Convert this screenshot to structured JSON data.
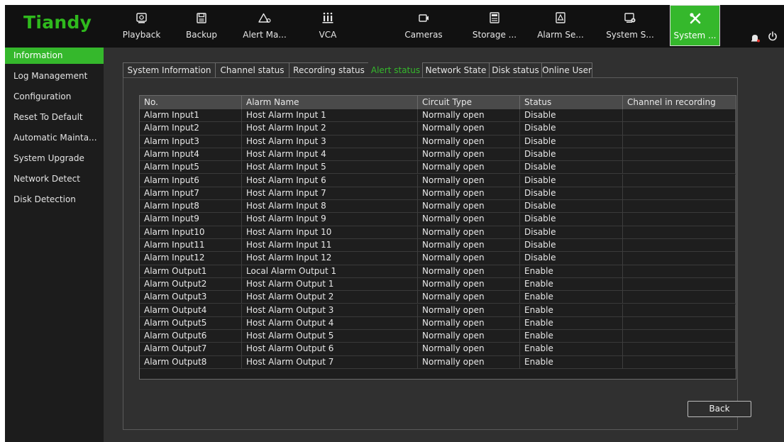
{
  "brand": {
    "logo_text": "Tiandy",
    "accent": "#35b82c"
  },
  "nav": [
    {
      "label": "Playback",
      "icon": "playback-icon"
    },
    {
      "label": "Backup",
      "icon": "backup-icon"
    },
    {
      "label": "Alert Ma...",
      "icon": "alert-icon"
    },
    {
      "label": "VCA",
      "icon": "vca-icon"
    },
    {
      "label": "Cameras",
      "icon": "camera-icon"
    },
    {
      "label": "Storage ...",
      "icon": "storage-icon"
    },
    {
      "label": "Alarm Se...",
      "icon": "alarm-settings-icon"
    },
    {
      "label": "System S...",
      "icon": "system-settings-icon"
    },
    {
      "label": "System ...",
      "icon": "tools-icon",
      "active": true
    }
  ],
  "sidebar": {
    "items": [
      {
        "label": "Information",
        "active": true
      },
      {
        "label": "Log Management"
      },
      {
        "label": "Configuration"
      },
      {
        "label": "Reset To Default"
      },
      {
        "label": "Automatic Mainta..."
      },
      {
        "label": "System Upgrade"
      },
      {
        "label": "Network Detect"
      },
      {
        "label": "Disk Detection"
      }
    ]
  },
  "tabs": [
    {
      "label": "System Information"
    },
    {
      "label": "Channel status"
    },
    {
      "label": "Recording status"
    },
    {
      "label": "Alert status",
      "active": true
    },
    {
      "label": "Network State"
    },
    {
      "label": "Disk status"
    },
    {
      "label": "Online User"
    }
  ],
  "table": {
    "columns": [
      "No.",
      "Alarm Name",
      "Circuit Type",
      "Status",
      "Channel in recording"
    ],
    "rows": [
      [
        "Alarm Input1",
        "Host Alarm Input 1",
        "Normally open",
        "Disable",
        ""
      ],
      [
        "Alarm Input2",
        "Host Alarm Input 2",
        "Normally open",
        "Disable",
        ""
      ],
      [
        "Alarm Input3",
        "Host Alarm Input 3",
        "Normally open",
        "Disable",
        ""
      ],
      [
        "Alarm Input4",
        "Host Alarm Input 4",
        "Normally open",
        "Disable",
        ""
      ],
      [
        "Alarm Input5",
        "Host Alarm Input 5",
        "Normally open",
        "Disable",
        ""
      ],
      [
        "Alarm Input6",
        "Host Alarm Input 6",
        "Normally open",
        "Disable",
        ""
      ],
      [
        "Alarm Input7",
        "Host Alarm Input 7",
        "Normally open",
        "Disable",
        ""
      ],
      [
        "Alarm Input8",
        "Host Alarm Input 8",
        "Normally open",
        "Disable",
        ""
      ],
      [
        "Alarm Input9",
        "Host Alarm Input 9",
        "Normally open",
        "Disable",
        ""
      ],
      [
        "Alarm Input10",
        "Host Alarm Input 10",
        "Normally open",
        "Disable",
        ""
      ],
      [
        "Alarm Input11",
        "Host Alarm Input 11",
        "Normally open",
        "Disable",
        ""
      ],
      [
        "Alarm Input12",
        "Host Alarm Input 12",
        "Normally open",
        "Disable",
        ""
      ],
      [
        "Alarm Output1",
        "Local Alarm Output 1",
        "Normally open",
        "Enable",
        ""
      ],
      [
        "Alarm Output2",
        "Host Alarm Output 1",
        "Normally open",
        "Enable",
        ""
      ],
      [
        "Alarm Output3",
        "Host Alarm Output 2",
        "Normally open",
        "Enable",
        ""
      ],
      [
        "Alarm Output4",
        "Host Alarm Output 3",
        "Normally open",
        "Enable",
        ""
      ],
      [
        "Alarm Output5",
        "Host Alarm Output 4",
        "Normally open",
        "Enable",
        ""
      ],
      [
        "Alarm Output6",
        "Host Alarm Output 5",
        "Normally open",
        "Enable",
        ""
      ],
      [
        "Alarm Output7",
        "Host Alarm Output 6",
        "Normally open",
        "Enable",
        ""
      ],
      [
        "Alarm Output8",
        "Host Alarm Output 7",
        "Normally open",
        "Enable",
        ""
      ]
    ]
  },
  "actions": {
    "back_label": "Back"
  },
  "status_icons": {
    "notification": "bell-icon",
    "power": "power-icon",
    "notification_dot_color": "#e0312b"
  }
}
